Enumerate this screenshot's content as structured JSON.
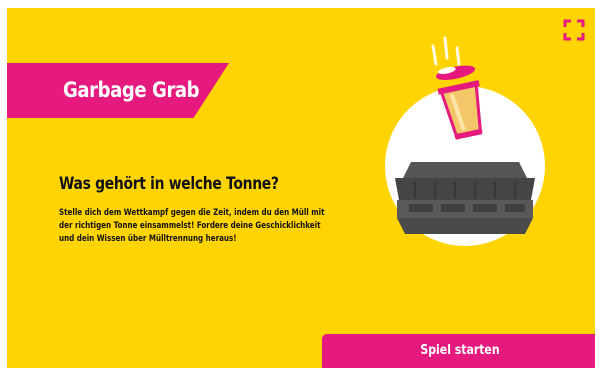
{
  "game": {
    "title": "Garbage Grab",
    "heading": "Was gehört in welche Tonne?",
    "description": "Stelle dich dem Wettkampf gegen die Zeit, indem du den Müll mit der richtigen Tonne einsammelst! Fordere deine Geschicklichkeit und dein Wissen über Mülltrennung heraus!",
    "start_button_label": "Spiel starten"
  },
  "controls": {
    "fullscreen_icon": "fullscreen-icon"
  },
  "illustration": {
    "items": [
      "falling-cup-icon",
      "garbage-bin-icon"
    ]
  },
  "colors": {
    "background": "#ffd400",
    "accent": "#e6197f",
    "text": "#111111",
    "bin": "#4a4a4a",
    "circle": "#ffffff"
  }
}
